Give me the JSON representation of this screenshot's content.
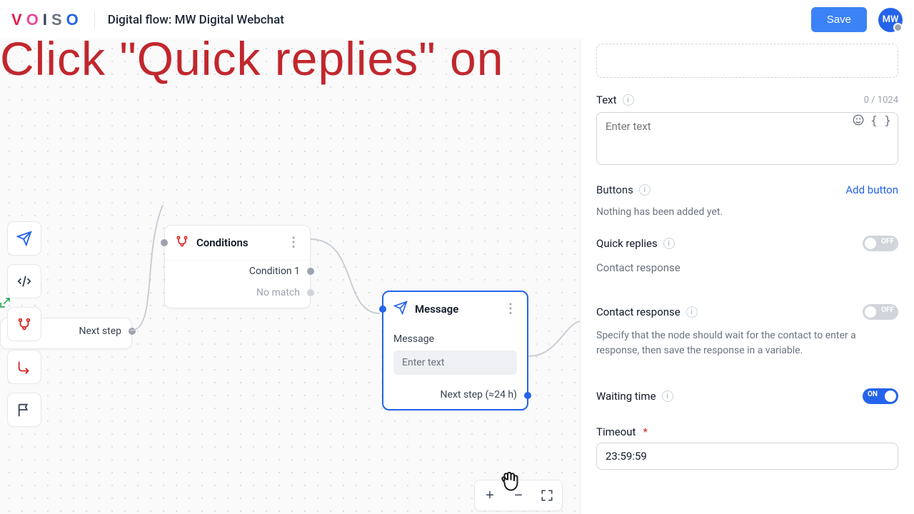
{
  "header": {
    "logo_letters": [
      "V",
      "O",
      "I",
      "S",
      "O"
    ],
    "title": "Digital flow: MW Digital Webchat",
    "save": "Save",
    "avatar_initials": "MW"
  },
  "instruction": "Click \"Quick replies\" on",
  "canvas": {
    "start_node": {
      "next_label": "Next step"
    },
    "conditions_node": {
      "title": "Conditions",
      "rows": {
        "cond1": "Condition 1",
        "no_match": "No match"
      }
    },
    "message_node": {
      "title": "Message",
      "sub_label": "Message",
      "placeholder": "Enter text",
      "next_label": "Next step (≈24 h)"
    }
  },
  "panel": {
    "text": {
      "label": "Text",
      "counter": "0 / 1024",
      "placeholder": "Enter text"
    },
    "buttons": {
      "label": "Buttons",
      "add": "Add button",
      "empty": "Nothing has been added yet."
    },
    "quick_replies": {
      "label": "Quick replies",
      "sub": "Contact response",
      "toggle": "OFF"
    },
    "contact_response": {
      "label": "Contact response",
      "toggle": "OFF",
      "desc": "Specify that the node should wait for the contact to enter a response, then save the response in a variable."
    },
    "waiting_time": {
      "label": "Waiting time",
      "toggle": "ON"
    },
    "timeout": {
      "label": "Timeout",
      "value": "23:59:59"
    }
  },
  "zoom": {
    "in": "+",
    "out": "−"
  }
}
